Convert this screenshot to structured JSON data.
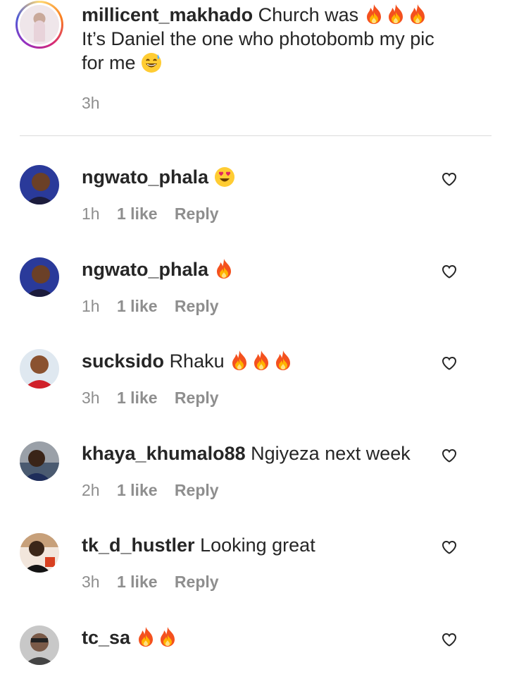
{
  "caption": {
    "username": "millicent_makhado",
    "text_line1": "Church was",
    "text_line2": "It’s Daniel the one who photobomb my pic",
    "text_line3": "for me",
    "time": "3h"
  },
  "comments": [
    {
      "username": "ngwato_phala",
      "text": "",
      "emoji": "heart-eyes",
      "time": "1h",
      "likes": "1 like",
      "reply": "Reply"
    },
    {
      "username": "ngwato_phala",
      "text": "",
      "emoji": "fire",
      "time": "1h",
      "likes": "1 like",
      "reply": "Reply"
    },
    {
      "username": "sucksido",
      "text": "Rhaku",
      "emoji": "fire x3",
      "time": "3h",
      "likes": "1 like",
      "reply": "Reply"
    },
    {
      "username": "khaya_khumalo88",
      "text": "Ngiyeza next week",
      "emoji": "",
      "time": "2h",
      "likes": "1 like",
      "reply": "Reply"
    },
    {
      "username": "tk_d_hustler",
      "text": "Looking great",
      "emoji": "",
      "time": "3h",
      "likes": "1 like",
      "reply": "Reply"
    },
    {
      "username": "tc_sa",
      "text": "",
      "emoji": "fire x2",
      "time": "",
      "likes": "",
      "reply": ""
    }
  ],
  "colors": {
    "text": "#262626",
    "muted": "#8e8e8e",
    "divider": "#dbdbdb",
    "fire": "#ff6a00"
  }
}
